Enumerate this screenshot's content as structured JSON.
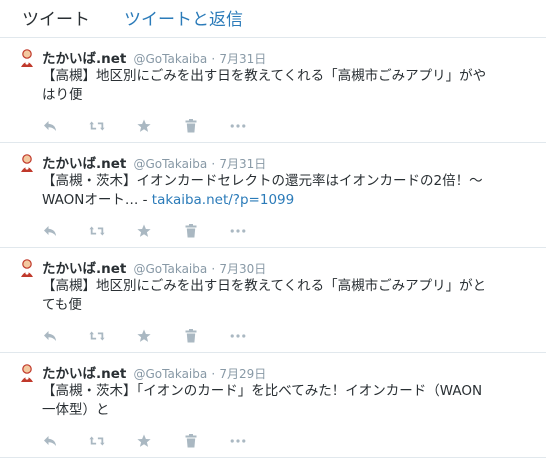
{
  "tabs": [
    {
      "label": "ツイート"
    },
    {
      "label": "ツイートと返信"
    }
  ],
  "tweets": [
    {
      "fullname": "たかいば.net",
      "username": "@GoTakaiba",
      "dot": "·",
      "time": "7月31日",
      "text": "【高槻】地区別にごみを出す日を教えてくれる「高槻市ごみアプリ」がや\nはり便",
      "link": ""
    },
    {
      "fullname": "たかいば.net",
      "username": "@GoTakaiba",
      "dot": "·",
      "time": "7月31日",
      "text": "【高槻・茨木】イオンカードセレクトの還元率はイオンカードの2倍！〜\nWAONオート… - ",
      "link": "takaiba.net/?p=1099"
    },
    {
      "fullname": "たかいば.net",
      "username": "@GoTakaiba",
      "dot": "·",
      "time": "7月30日",
      "text": "【高槻】地区別にごみを出す日を教えてくれる「高槻市ごみアプリ」がと\nても便",
      "link": ""
    },
    {
      "fullname": "たかいば.net",
      "username": "@GoTakaiba",
      "dot": "·",
      "time": "7月29日",
      "text": "【高槻・茨木】「イオンのカード」を比べてみた！イオンカード（WAON\n一体型）と",
      "link": ""
    }
  ],
  "icons": {
    "reply": "reply-icon",
    "retweet": "retweet-icon",
    "favorite": "star-icon",
    "delete": "trash-icon",
    "more": "more-icon",
    "avatar": "avatar-icon"
  },
  "colors": {
    "link": "#2b7bb9",
    "muted": "#8899a6",
    "action_icon": "#aab8c2",
    "divider": "#e1e8ed"
  }
}
